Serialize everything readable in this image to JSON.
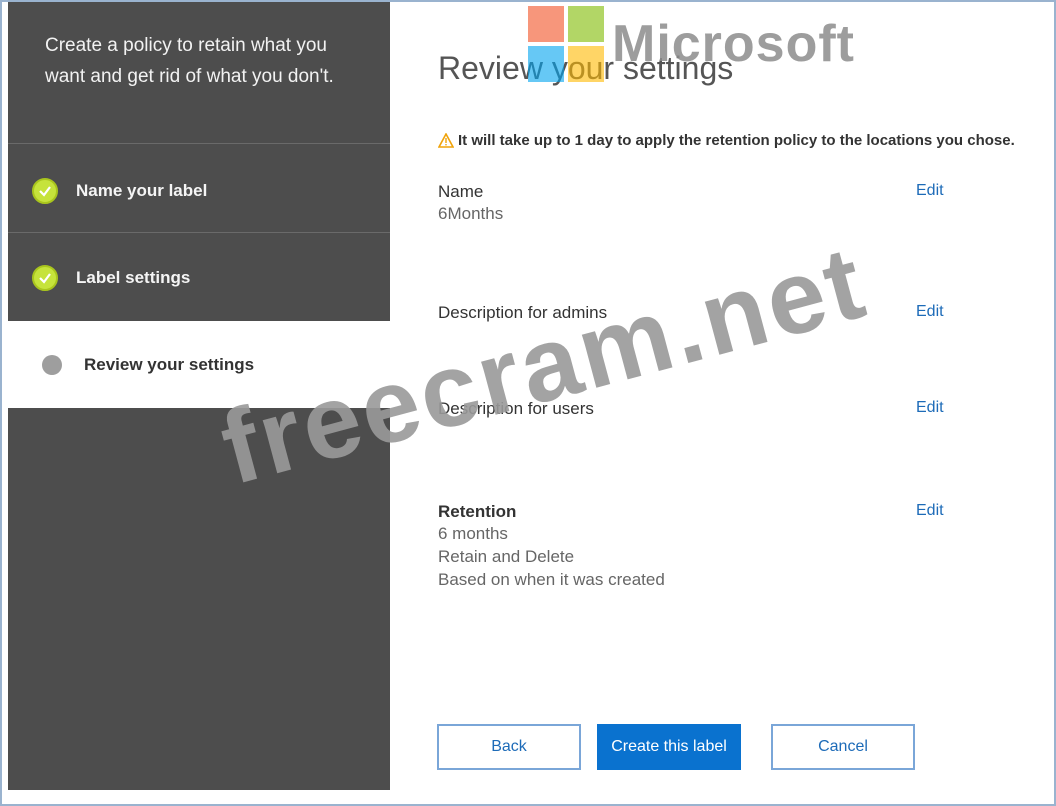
{
  "sidebar": {
    "intro": "Create a policy to retain what you want and get rid of what you don't.",
    "steps": [
      {
        "label": "Name your label",
        "state": "complete"
      },
      {
        "label": "Label settings",
        "state": "complete"
      },
      {
        "label": "Review your settings",
        "state": "current"
      }
    ]
  },
  "main": {
    "title": "Review your settings",
    "warning": "It will take up to 1 day to apply the retention policy to the locations you chose.",
    "fields": {
      "name": {
        "label": "Name",
        "value": "6Months"
      },
      "admin_desc": {
        "label": "Description for admins"
      },
      "user_desc": {
        "label": "Description for users"
      },
      "retention": {
        "label": "Retention",
        "lines": [
          "6 months",
          "Retain and Delete",
          "Based on when it was created"
        ]
      }
    },
    "edit_label": "Edit"
  },
  "buttons": {
    "back": "Back",
    "create": "Create this label",
    "cancel": "Cancel"
  },
  "overlay": {
    "logo_text": "Microsoft",
    "watermark": "freecram.net"
  },
  "colors": {
    "sidebar_bg": "#4d4d4d",
    "check_green": "#c6e33b",
    "primary_blue": "#0a72cf",
    "link_blue": "#1d6bb8",
    "warning_orange": "#f0a30a"
  }
}
